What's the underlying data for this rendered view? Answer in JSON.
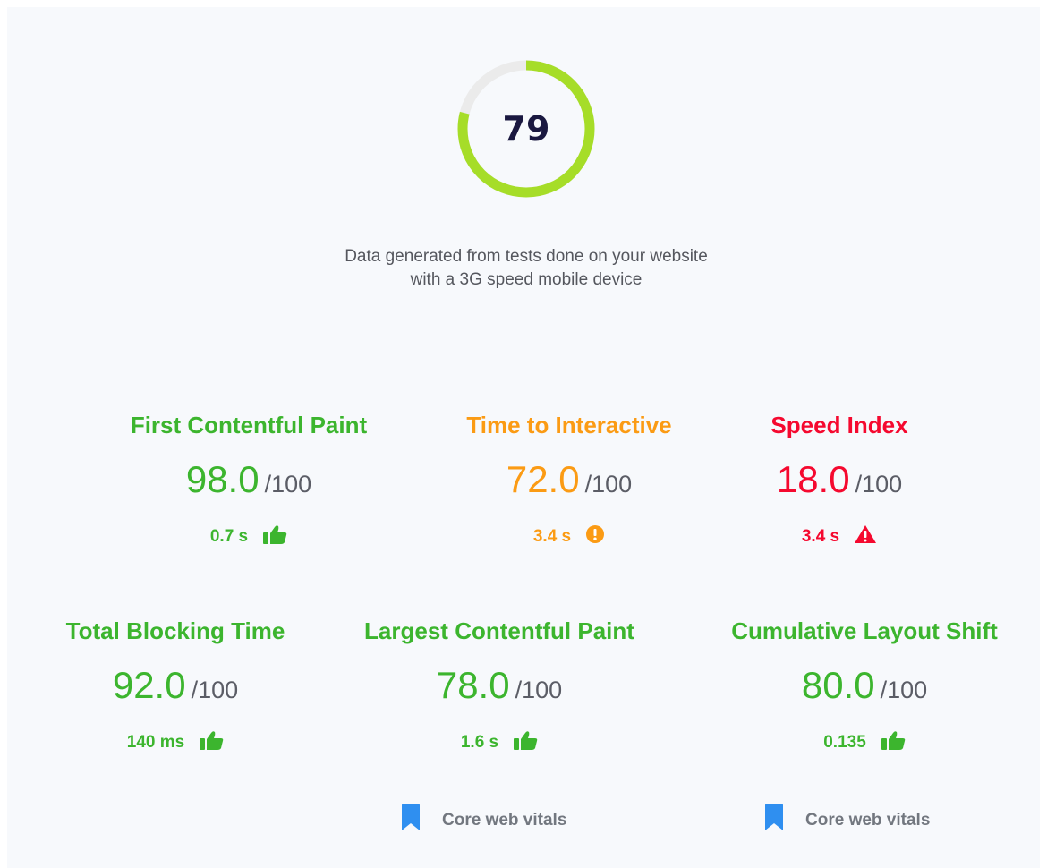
{
  "overall": {
    "score": "79",
    "score_fraction": 0.79,
    "ring_color": "#a6dd28",
    "track_color": "#ebebeb"
  },
  "description": "Data generated from tests done on your website with a 3G speed mobile device",
  "metrics": [
    {
      "name": "First Contentful Paint",
      "score": "98.0",
      "max": "/100",
      "timing": "0.7 s",
      "status": "good",
      "icon": "thumbs-up-icon",
      "color": "#3cb52e"
    },
    {
      "name": "Time to Interactive",
      "score": "72.0",
      "max": "/100",
      "timing": "3.4 s",
      "status": "average",
      "icon": "exclamation-circle-icon",
      "color": "#fb9b14"
    },
    {
      "name": "Speed Index",
      "score": "18.0",
      "max": "/100",
      "timing": "3.4 s",
      "status": "poor",
      "icon": "warning-triangle-icon",
      "color": "#f5092f"
    },
    {
      "name": "Total Blocking Time",
      "score": "92.0",
      "max": "/100",
      "timing": "140 ms",
      "status": "good",
      "icon": "thumbs-up-icon",
      "color": "#3cb52e"
    },
    {
      "name": "Largest Contentful Paint",
      "score": "78.0",
      "max": "/100",
      "timing": "1.6 s",
      "status": "good",
      "icon": "thumbs-up-icon",
      "color": "#3cb52e",
      "tag": "Core web vitals"
    },
    {
      "name": "Cumulative Layout Shift",
      "score": "80.0",
      "max": "/100",
      "timing": "0.135",
      "status": "good",
      "icon": "thumbs-up-icon",
      "color": "#3cb52e",
      "tag": "Core web vitals"
    }
  ],
  "tag_icon": "bookmark-icon",
  "tag_icon_color": "#2f8ff0"
}
